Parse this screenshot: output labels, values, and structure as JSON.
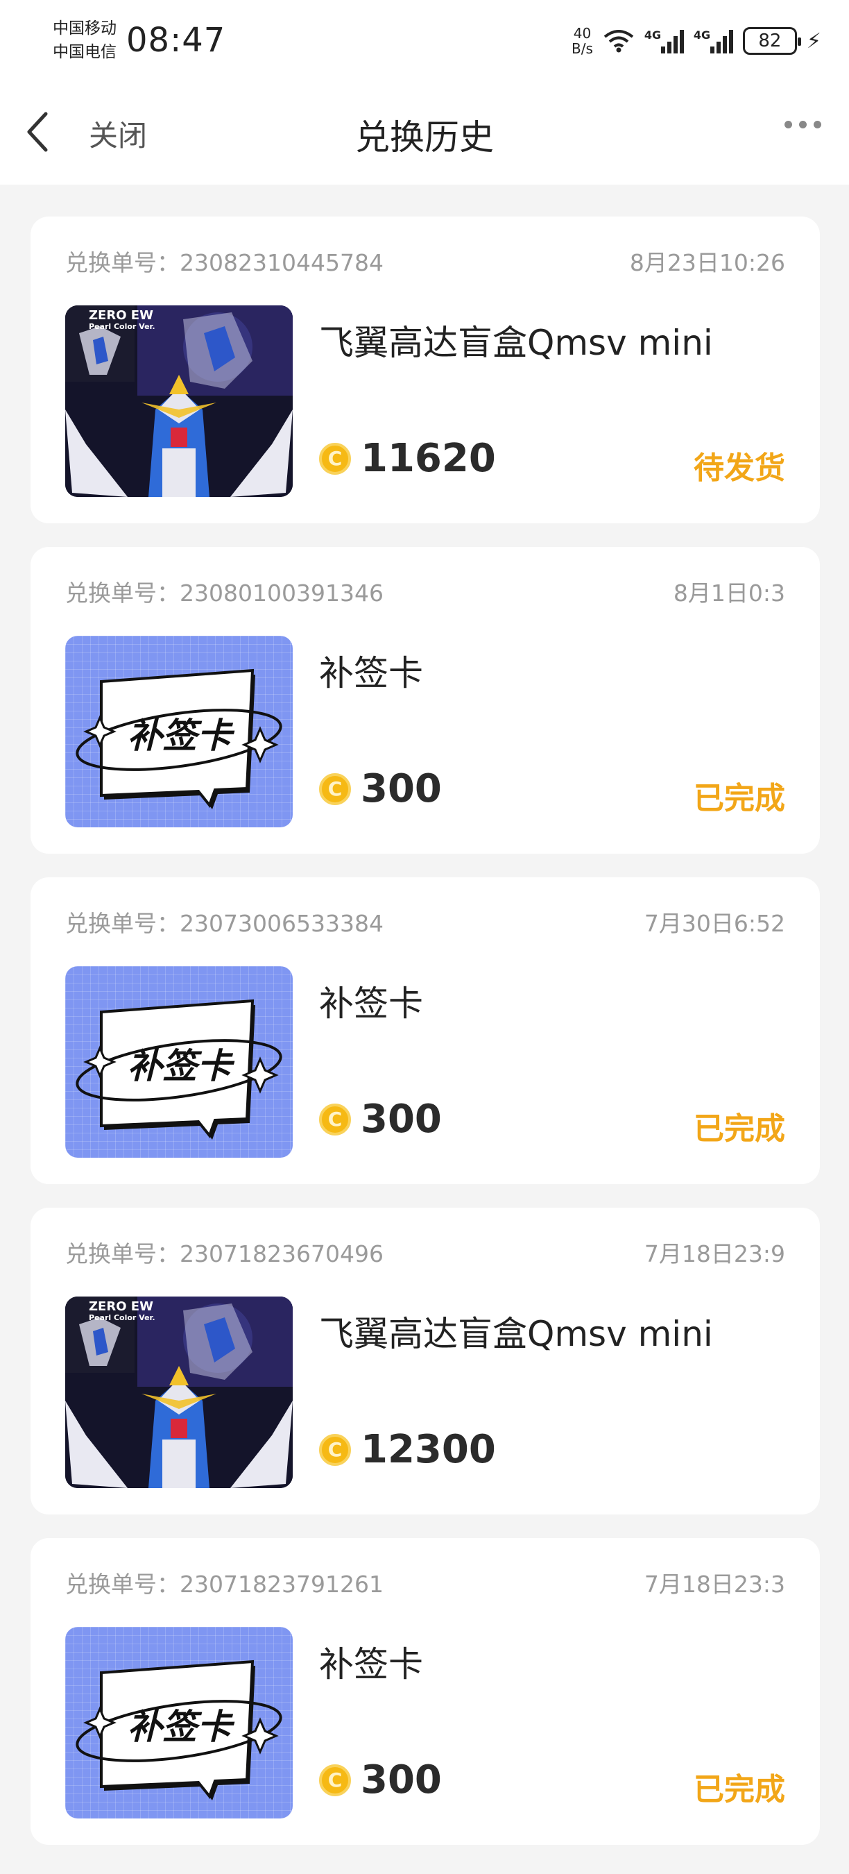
{
  "status_bar": {
    "carrier_1": "中国移动",
    "carrier_2": "中国电信",
    "time": "08:47",
    "net_speed_value": "40",
    "net_speed_unit": "B/s",
    "signal_1_tag": "4G",
    "signal_2_tag": "4G",
    "battery": "82"
  },
  "header": {
    "close_label": "关闭",
    "title": "兑换历史"
  },
  "orders": [
    {
      "order_label": "兑换单号：23082310445784",
      "date": "8月23日10:26",
      "title": "飞翼高达盲盒Qmsv mini",
      "price": "11620",
      "status": "待发货",
      "image": "gundam"
    },
    {
      "order_label": "兑换单号：23080100391346",
      "date": "8月1日0:3",
      "title": "补签卡",
      "price": "300",
      "status": "已完成",
      "image": "card"
    },
    {
      "order_label": "兑换单号：23073006533384",
      "date": "7月30日6:52",
      "title": "补签卡",
      "price": "300",
      "status": "已完成",
      "image": "card"
    },
    {
      "order_label": "兑换单号：23071823670496",
      "date": "7月18日23:9",
      "title": "飞翼高达盲盒Qmsv mini",
      "price": "12300",
      "status": "",
      "image": "gundam"
    },
    {
      "order_label": "兑换单号：23071823791261",
      "date": "7月18日23:3",
      "title": "补签卡",
      "price": "300",
      "status": "已完成",
      "image": "card"
    }
  ],
  "images": {
    "gundam_caption_1": "ZERO EW",
    "gundam_caption_2": "Pearl Color Ver.",
    "card_text": "补签卡"
  },
  "colors": {
    "accent": "#f2a618",
    "card_bg": "#7f96f2",
    "coin": "#f6b914",
    "page_bg": "#f4f4f4"
  }
}
